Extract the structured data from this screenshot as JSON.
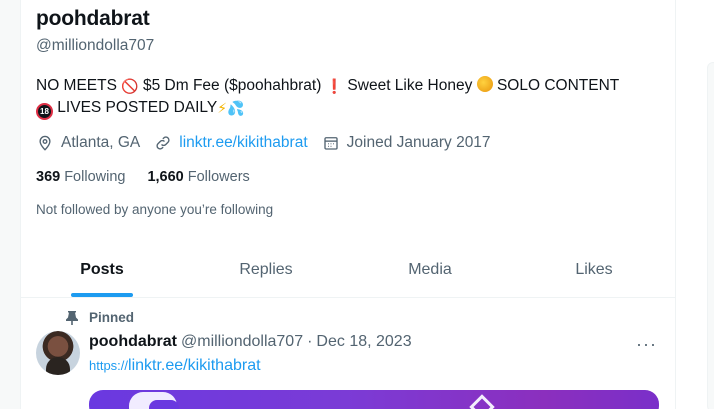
{
  "profile": {
    "display_name": "poohdabrat",
    "handle": "@milliondolla707",
    "bio": {
      "part1": "NO MEETS ",
      "no_entry": "🚫",
      "part2": " $5 Dm Fee ($poohahbrat) ",
      "exclaim": "❗",
      "part3": " Sweet Like Honey ",
      "honey": "🍯",
      "part4": " SOLO CONTENT",
      "eighteen": "18",
      "part5": " LIVES POSTED DAILY",
      "bolt": "⚡",
      "drops": "💦"
    },
    "location": "Atlanta, GA",
    "link": "linktr.ee/kikithabrat",
    "joined": "Joined January 2017",
    "following_count": "369",
    "following_label": "Following",
    "followers_count": "1,660",
    "followers_label": "Followers",
    "not_followed": "Not followed by anyone you’re following"
  },
  "tabs": [
    {
      "label": "Posts",
      "active": true
    },
    {
      "label": "Replies",
      "active": false
    },
    {
      "label": "Media",
      "active": false
    },
    {
      "label": "Likes",
      "active": false
    }
  ],
  "pinned_tweet": {
    "pinned_label": "Pinned",
    "name": "poohdabrat",
    "handle": "@milliondolla707",
    "separator": "·",
    "date": "Dec 18, 2023",
    "more": "···",
    "link_scheme": "https://",
    "link_rest": "linktr.ee/kikithabrat"
  },
  "icons": {
    "location": "location-pin-icon",
    "link": "link-icon",
    "calendar": "calendar-icon",
    "pin": "pin-icon",
    "more": "more-horizontal-icon"
  },
  "colors": {
    "accent": "#1d9bf0",
    "text_primary": "#0f1419",
    "text_secondary": "#536471"
  }
}
